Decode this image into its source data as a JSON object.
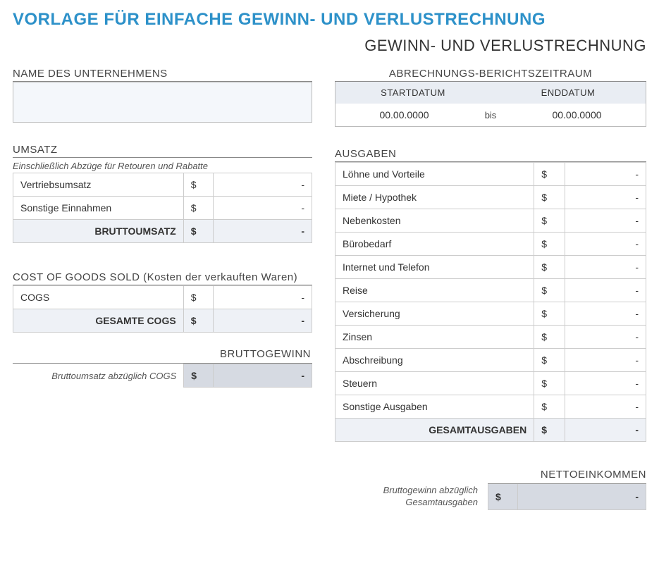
{
  "main_title": "VORLAGE FÜR EINFACHE GEWINN- UND VERLUSTRECHNUNG",
  "sub_title": "GEWINN- UND VERLUSTRECHNUNG",
  "company": {
    "label": "NAME DES UNTERNEHMENS",
    "value": ""
  },
  "period": {
    "label": "ABRECHNUNGS-BERICHTSZEITRAUM",
    "start_label": "STARTDATUM",
    "end_label": "ENDDATUM",
    "start_value": "00.00.0000",
    "separator": "bis",
    "end_value": "00.00.0000"
  },
  "currency": "$",
  "dash": "-",
  "revenue": {
    "label": "UMSATZ",
    "note": "Einschließlich Abzüge für Retouren und Rabatte",
    "rows": [
      {
        "label": "Vertriebsumsatz",
        "value": "-"
      },
      {
        "label": "Sonstige Einnahmen",
        "value": "-"
      }
    ],
    "total_label": "BRUTTOUMSATZ",
    "total_value": "-"
  },
  "cogs": {
    "label": "COST OF GOODS SOLD (Kosten der verkauften Waren)",
    "rows": [
      {
        "label": "COGS",
        "value": "-"
      }
    ],
    "total_label": "GESAMTE COGS",
    "total_value": "-"
  },
  "gross_profit": {
    "label": "BRUTTOGEWINN",
    "note": "Bruttoumsatz abzüglich COGS",
    "value": "-"
  },
  "expenses": {
    "label": "AUSGABEN",
    "rows": [
      {
        "label": "Löhne und Vorteile",
        "value": "-"
      },
      {
        "label": "Miete / Hypothek",
        "value": "-"
      },
      {
        "label": "Nebenkosten",
        "value": "-"
      },
      {
        "label": "Bürobedarf",
        "value": "-"
      },
      {
        "label": "Internet und Telefon",
        "value": "-"
      },
      {
        "label": "Reise",
        "value": "-"
      },
      {
        "label": "Versicherung",
        "value": "-"
      },
      {
        "label": "Zinsen",
        "value": "-"
      },
      {
        "label": "Abschreibung",
        "value": "-"
      },
      {
        "label": "Steuern",
        "value": "-"
      },
      {
        "label": "Sonstige Ausgaben",
        "value": "-"
      }
    ],
    "total_label": "GESAMTAUSGABEN",
    "total_value": "-"
  },
  "net_income": {
    "label": "NETTOEINKOMMEN",
    "note_line1": "Bruttogewinn abzüglich",
    "note_line2": "Gesamtausgaben",
    "value": "-"
  }
}
